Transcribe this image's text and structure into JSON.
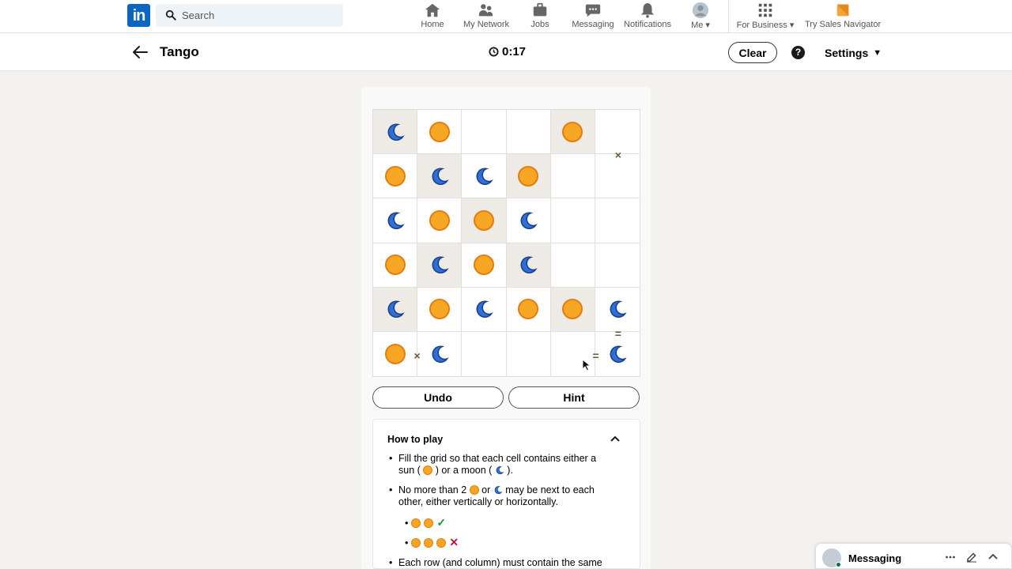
{
  "nav": {
    "logo": "in",
    "search_placeholder": "Search",
    "items": [
      {
        "label": "Home",
        "icon": "home-icon"
      },
      {
        "label": "My Network",
        "icon": "network-icon"
      },
      {
        "label": "Jobs",
        "icon": "briefcase-icon"
      },
      {
        "label": "Messaging",
        "icon": "messaging-icon"
      },
      {
        "label": "Notifications",
        "icon": "bell-icon"
      },
      {
        "label": "Me",
        "icon": "avatar"
      },
      {
        "label": "For Business",
        "icon": "grid-icon"
      },
      {
        "label": "Try Sales Navigator",
        "icon": "sales-navigator-icon"
      }
    ]
  },
  "game": {
    "title": "Tango",
    "timer": "0:17",
    "clear_label": "Clear",
    "help_label": "?",
    "settings_label": "Settings",
    "undo_label": "Undo",
    "hint_label": "Hint",
    "grid": [
      [
        "M",
        "S",
        "",
        "",
        "S",
        ""
      ],
      [
        "S",
        "M",
        "M",
        "S",
        "",
        ""
      ],
      [
        "M",
        "S",
        "S",
        "M",
        "",
        ""
      ],
      [
        "S",
        "M",
        "S",
        "M",
        "",
        ""
      ],
      [
        "M",
        "S",
        "M",
        "S",
        "S",
        "M"
      ],
      [
        "S",
        "M",
        "",
        "",
        "",
        "M"
      ]
    ],
    "locked": [
      [
        1,
        0,
        0,
        0,
        1,
        0
      ],
      [
        0,
        1,
        0,
        1,
        0,
        0
      ],
      [
        0,
        0,
        1,
        0,
        0,
        0
      ],
      [
        0,
        1,
        0,
        1,
        0,
        0
      ],
      [
        1,
        0,
        0,
        0,
        1,
        0
      ],
      [
        0,
        0,
        0,
        0,
        0,
        0
      ]
    ],
    "constraints": [
      {
        "label": "×",
        "cell_a": [
          0,
          5
        ],
        "cell_b": [
          1,
          5
        ]
      },
      {
        "label": "=",
        "cell_a": [
          4,
          5
        ],
        "cell_b": [
          5,
          5
        ]
      },
      {
        "label": "×",
        "cell_a": [
          5,
          0
        ],
        "cell_b": [
          5,
          1
        ]
      },
      {
        "label": "=",
        "cell_a": [
          5,
          4
        ],
        "cell_b": [
          5,
          5
        ]
      }
    ]
  },
  "howto": {
    "title": "How to play",
    "rule1_a": "Fill the grid so that each cell contains either a",
    "rule1_b_pre": "sun (",
    "rule1_b_mid": ") or a moon (",
    "rule1_b_post": ").",
    "rule2_pre": "No more than 2",
    "rule2_or": "or",
    "rule2_post": "may be next to each",
    "rule2_line2": "other, either vertically or horizontally.",
    "example_ok": "✓",
    "example_bad": "✕",
    "rule3": "Each row (and column) must contain the same"
  },
  "messaging": {
    "label": "Messaging"
  },
  "colors": {
    "linkedin_blue": "#0a66c2",
    "sun": "#f6a623",
    "moon": "#2f6fd6",
    "locked_cell": "#eeeae6"
  }
}
